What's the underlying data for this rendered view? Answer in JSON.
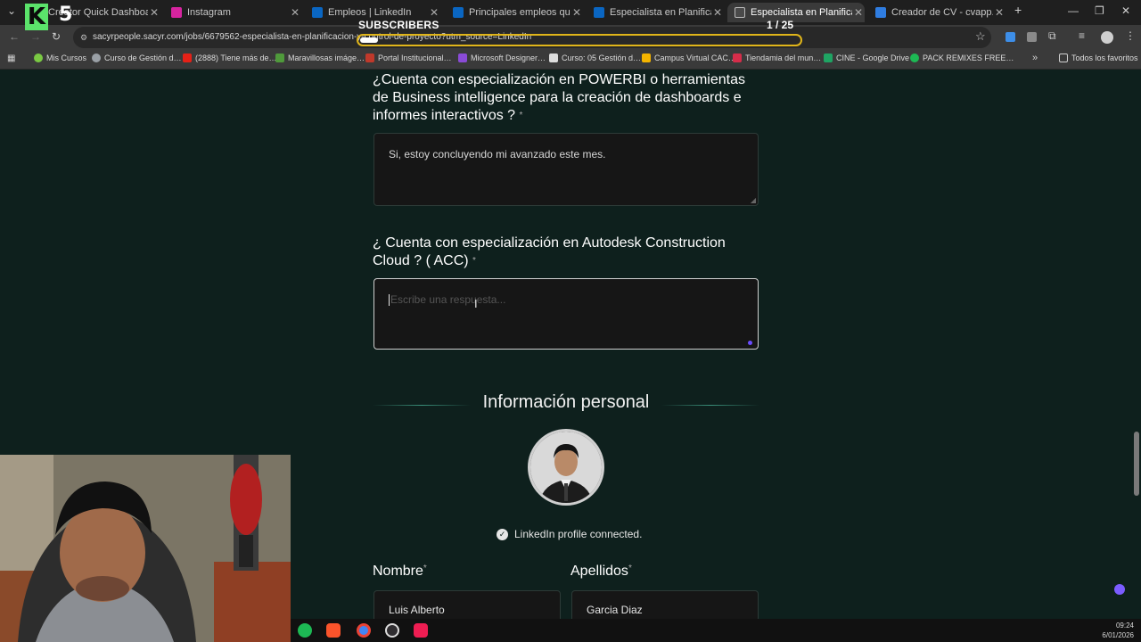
{
  "browser": {
    "tabs": [
      {
        "label": "Creator Quick Dashboard",
        "color": "#c9302c",
        "active": false
      },
      {
        "label": "Instagram",
        "color": "#d6249f",
        "active": false
      },
      {
        "label": "Empleos | LinkedIn",
        "color": "#0a66c2",
        "active": false
      },
      {
        "label": "Principales empleos que te re…",
        "color": "#0a66c2",
        "active": false
      },
      {
        "label": "Especialista en Planificación y C…",
        "color": "#0a66c2",
        "active": false
      },
      {
        "label": "Especialista en Planificación y C…",
        "color": "#4a4a4a",
        "active": true
      },
      {
        "label": "Creador de CV - cvapp.es",
        "color": "#2f7de1",
        "active": false
      }
    ],
    "new_tab_symbol": "+",
    "url": "sacyrpeople.sacyr.com/jobs/6679562-especialista-en-planificacion-y-control-de-proyecto?utm_source=LinkedIn",
    "bookmarks": [
      {
        "label": "Mis Cursos",
        "color": "#7ac943"
      },
      {
        "label": "Curso de Gestión d…",
        "color": "#9aa0a6"
      },
      {
        "label": "(2888) Tiene más de…",
        "color": "#e62117"
      },
      {
        "label": "Maravillosas imáge…",
        "color": "#4f9a3b"
      },
      {
        "label": "Portal Institucional…",
        "color": "#c0392b"
      },
      {
        "label": "Microsoft Designer…",
        "color": "#8a4bd6"
      },
      {
        "label": "Curso: 05 Gestión d…",
        "color": "#dddddd"
      },
      {
        "label": "Campus Virtual CAC…",
        "color": "#f4b400"
      },
      {
        "label": "Tiendamia del mun…",
        "color": "#d62d4a"
      },
      {
        "label": "CINE - Google Drive",
        "color": "#1fa463"
      },
      {
        "label": "PACK REMIXES FREE…",
        "color": "#1db954"
      }
    ],
    "favorites_label": "Todos los favoritos"
  },
  "overlay": {
    "logo_letter": "K",
    "logo_number": "5",
    "subscribers_label": "SUBSCRIBERS",
    "subscribers_count": "1 / 25",
    "subscribers_progress": 0.04
  },
  "form": {
    "q1": {
      "title": "¿Cuenta con especialización en POWERBI o herramientas de Business intelligence para la creación de dashboards e informes interactivos ?",
      "required_mark": "*",
      "answer": "Si, estoy concluyendo mi avanzado este mes."
    },
    "q2": {
      "title": "¿ Cuenta con especialización en Autodesk Construction Cloud ? ( ACC)",
      "required_mark": "*",
      "placeholder": "Escribe una respuesta..."
    },
    "section_title": "Información personal",
    "linkedin_status": "LinkedIn profile connected.",
    "nombre_label": "Nombre",
    "nombre_value": "Luis Alberto",
    "apellidos_label": "Apellidos",
    "apellidos_value": "Garcia Diaz"
  },
  "taskbar": {
    "icons": [
      {
        "name": "spotify-icon",
        "color": "#1db954"
      },
      {
        "name": "brave-icon",
        "color": "#fb542b"
      },
      {
        "name": "chrome-icon",
        "color": "#4285f4"
      },
      {
        "name": "obs-icon",
        "color": "#302e31"
      },
      {
        "name": "tiktok-icon",
        "color": "#ee1d52"
      }
    ],
    "time": "09:24",
    "date": "6/01/2026"
  }
}
